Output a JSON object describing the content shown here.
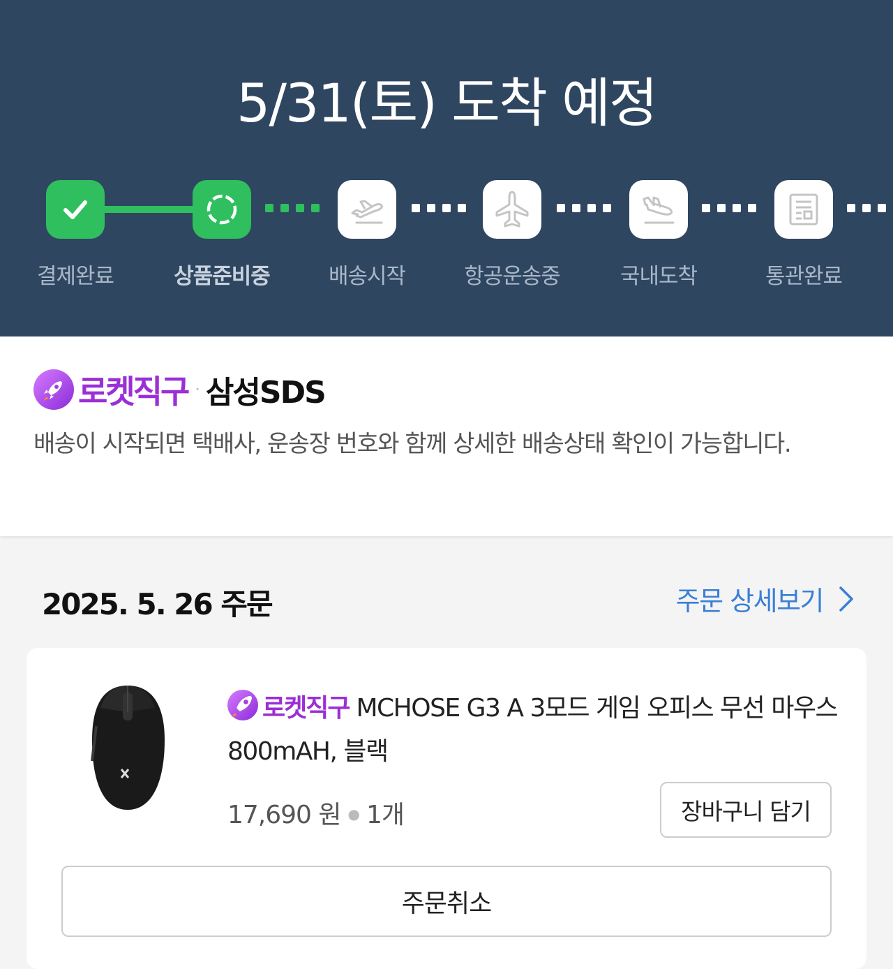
{
  "header": {
    "eta": "5/31(토) 도착 예정",
    "steps": [
      {
        "label": "결제완료",
        "state": "done",
        "icon": "check-icon"
      },
      {
        "label": "상품준비중",
        "state": "current",
        "icon": "loading-circle-icon"
      },
      {
        "label": "배송시작",
        "state": "todo",
        "icon": "departure-plane-icon"
      },
      {
        "label": "항공운송중",
        "state": "todo",
        "icon": "airplane-icon"
      },
      {
        "label": "국내도착",
        "state": "todo",
        "icon": "arrival-plane-icon"
      },
      {
        "label": "통관완료",
        "state": "todo",
        "icon": "document-icon"
      }
    ],
    "colors": {
      "background": "#2f4661",
      "done": "#2fbf5e"
    }
  },
  "delivery_info": {
    "brand": "로켓직구",
    "carrier": "삼성SDS",
    "notice": "배송이 시작되면 택배사, 운송장 번호와 함께 상세한 배송상태 확인이 가능합니다."
  },
  "order": {
    "date": "2025. 5. 26 주문",
    "detail_link": "주문 상세보기",
    "item": {
      "brand": "로켓직구",
      "name": "MCHOSE G3 A 3모드 게임 오피스 무선 마우스 800mAH, 블랙",
      "price": "17,690 원",
      "quantity": "1개",
      "cart_button": "장바구니 담기"
    },
    "cancel_button": "주문취소"
  }
}
